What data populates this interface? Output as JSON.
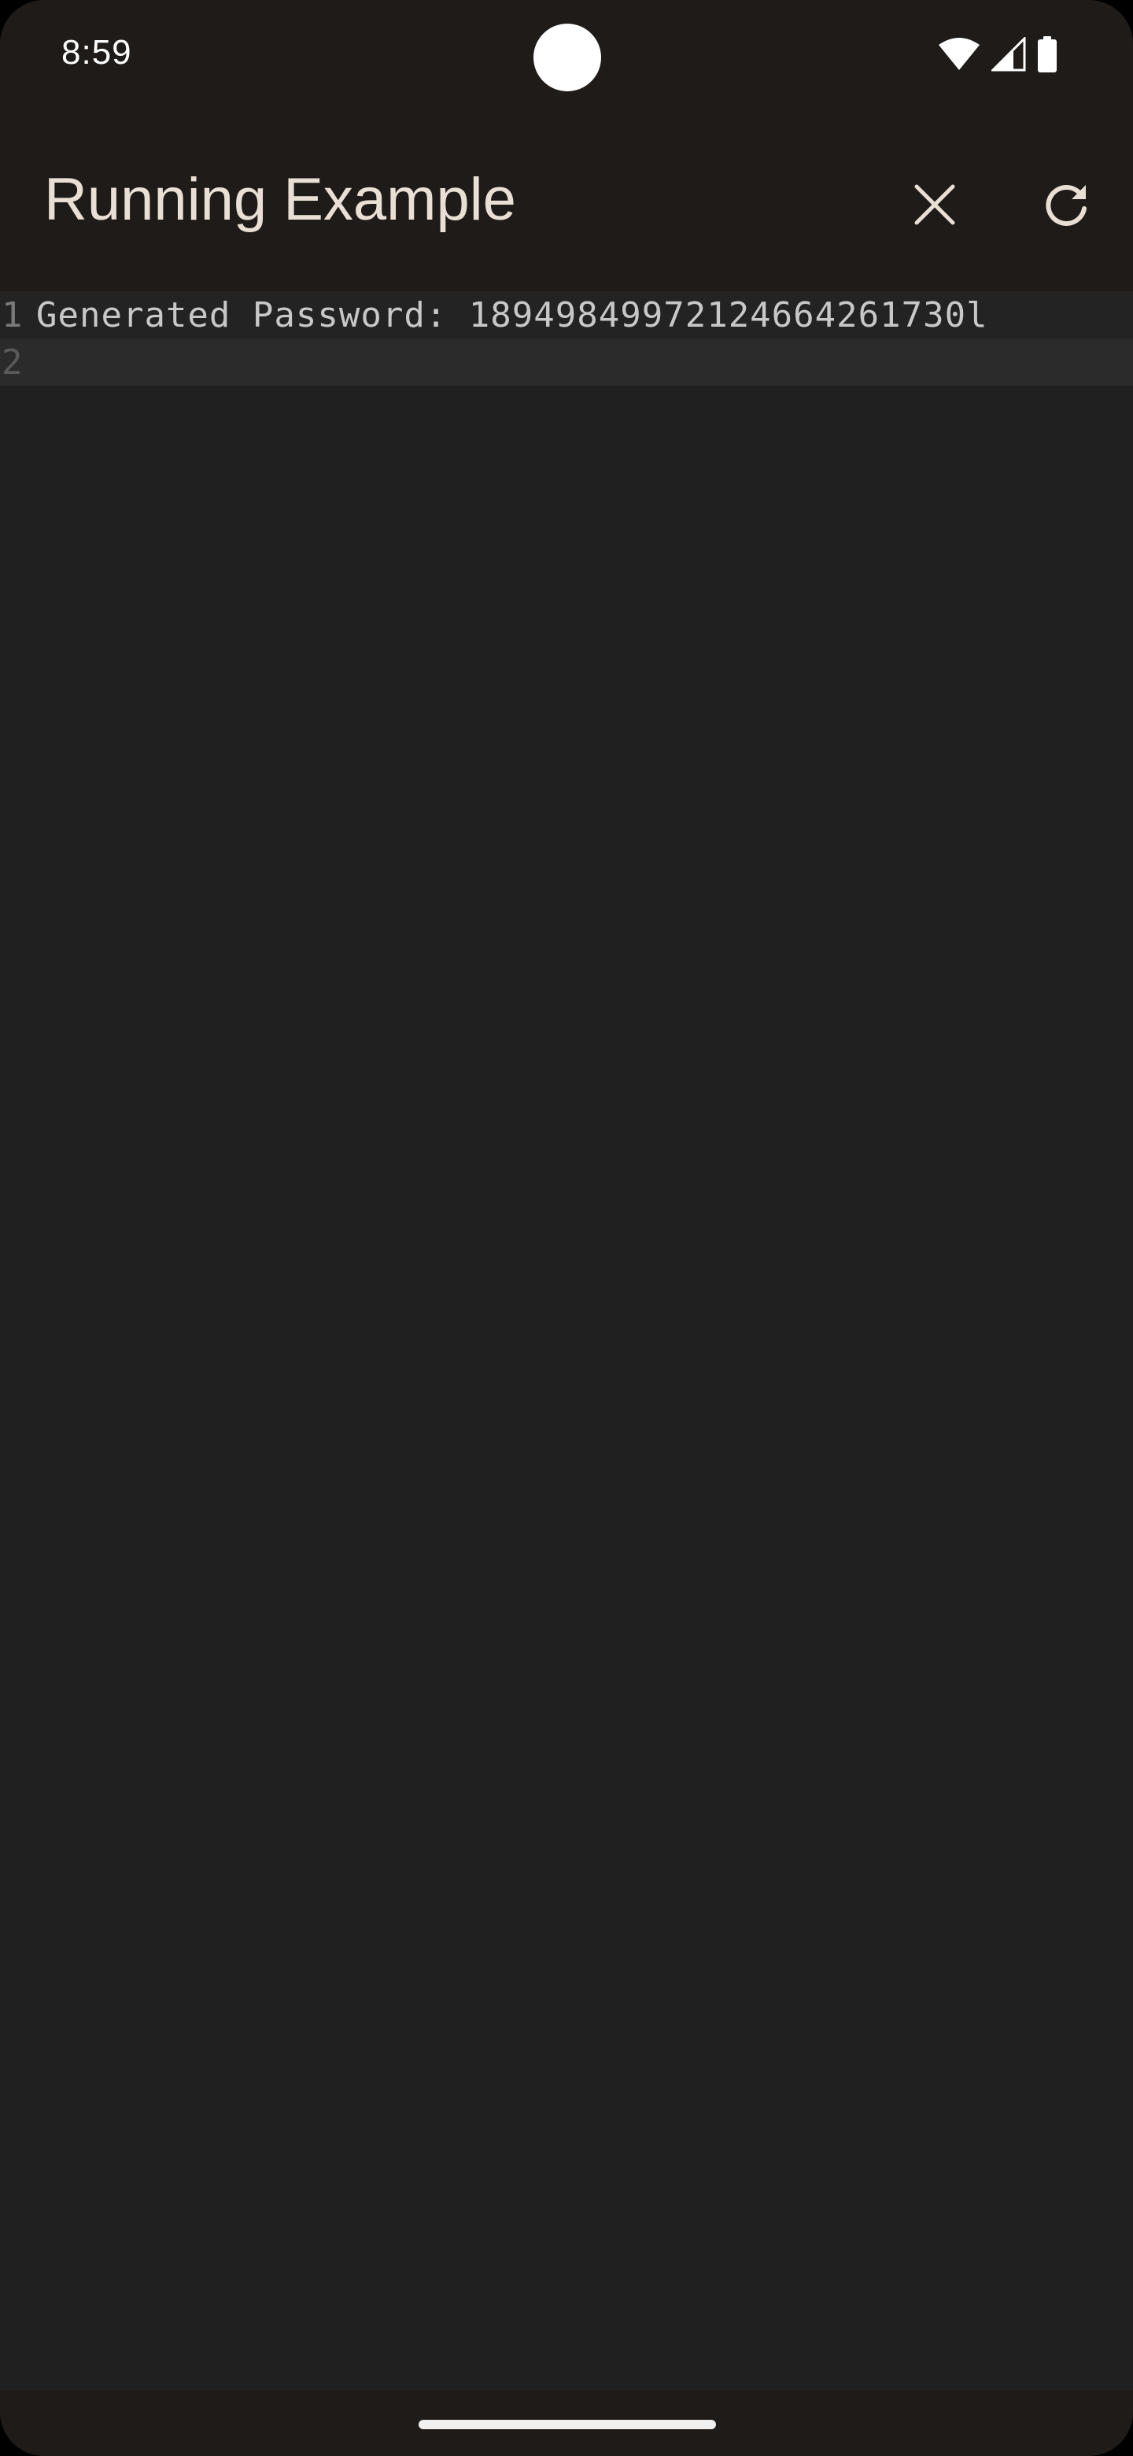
{
  "status_bar": {
    "time": "8:59",
    "icons": [
      "wifi-icon",
      "cellular-signal-icon",
      "battery-icon"
    ]
  },
  "app_bar": {
    "title": "Running Example",
    "actions": [
      "close-icon",
      "refresh-icon"
    ]
  },
  "editor": {
    "lines": [
      {
        "number": "1",
        "text": "Generated Password: 18949849972124664261730l"
      },
      {
        "number": "2",
        "text": ""
      }
    ]
  },
  "colors": {
    "app_bar_bg": "#1e1b18",
    "editor_bg": "#202020",
    "title_color": "#e9dfd4",
    "code_color": "#c8c8c8"
  }
}
